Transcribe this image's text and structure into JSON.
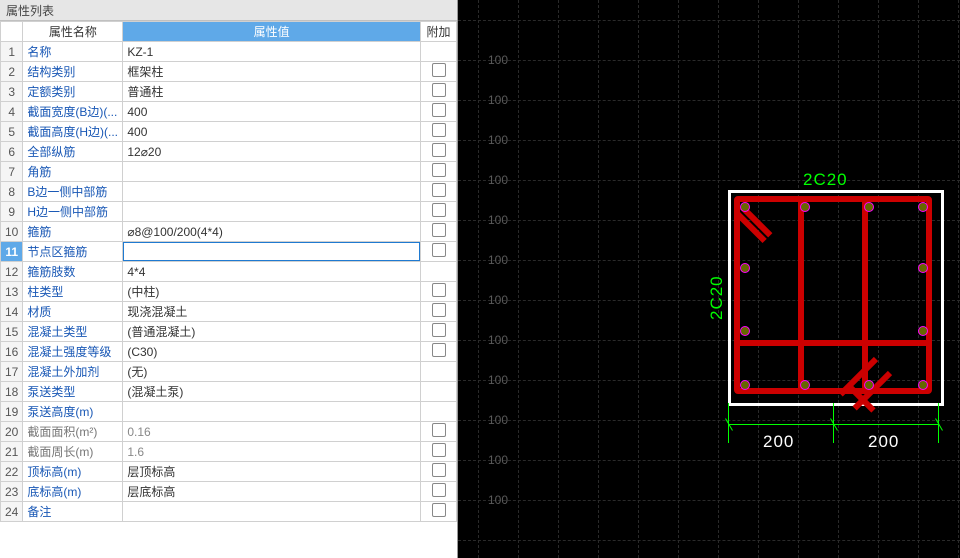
{
  "panel": {
    "title": "属性列表",
    "col_name": "属性名称",
    "col_value": "属性值",
    "col_extra": "附加"
  },
  "selected_row_index": 10,
  "rows": [
    {
      "n": "1",
      "name": "名称",
      "val": "KZ-1",
      "chk": false,
      "edit": false,
      "gray": false
    },
    {
      "n": "2",
      "name": "结构类别",
      "val": "框架柱",
      "chk": true,
      "edit": false,
      "gray": false
    },
    {
      "n": "3",
      "name": "定额类别",
      "val": "普通柱",
      "chk": true,
      "edit": false,
      "gray": false
    },
    {
      "n": "4",
      "name": "截面宽度(B边)(...",
      "val": "400",
      "chk": true,
      "edit": false,
      "gray": false
    },
    {
      "n": "5",
      "name": "截面高度(H边)(...",
      "val": "400",
      "chk": true,
      "edit": false,
      "gray": false
    },
    {
      "n": "6",
      "name": "全部纵筋",
      "val": "12⌀20",
      "chk": true,
      "edit": false,
      "gray": false
    },
    {
      "n": "7",
      "name": "角筋",
      "val": "",
      "chk": true,
      "edit": false,
      "gray": false
    },
    {
      "n": "8",
      "name": "B边一侧中部筋",
      "val": "",
      "chk": true,
      "edit": false,
      "gray": false
    },
    {
      "n": "9",
      "name": "H边一侧中部筋",
      "val": "",
      "chk": true,
      "edit": false,
      "gray": false
    },
    {
      "n": "10",
      "name": "箍筋",
      "val": "⌀8@100/200(4*4)",
      "chk": true,
      "edit": false,
      "gray": false
    },
    {
      "n": "11",
      "name": "节点区箍筋",
      "val": "",
      "chk": true,
      "edit": true,
      "gray": false
    },
    {
      "n": "12",
      "name": "箍筋肢数",
      "val": "4*4",
      "chk": false,
      "edit": false,
      "gray": false
    },
    {
      "n": "13",
      "name": "柱类型",
      "val": "(中柱)",
      "chk": true,
      "edit": false,
      "gray": false
    },
    {
      "n": "14",
      "name": "材质",
      "val": "现浇混凝土",
      "chk": true,
      "edit": false,
      "gray": false
    },
    {
      "n": "15",
      "name": "混凝土类型",
      "val": "(普通混凝土)",
      "chk": true,
      "edit": false,
      "gray": false
    },
    {
      "n": "16",
      "name": "混凝土强度等级",
      "val": "(C30)",
      "chk": true,
      "edit": false,
      "gray": false
    },
    {
      "n": "17",
      "name": "混凝土外加剂",
      "val": "(无)",
      "chk": false,
      "edit": false,
      "gray": false
    },
    {
      "n": "18",
      "name": "泵送类型",
      "val": "(混凝土泵)",
      "chk": false,
      "edit": false,
      "gray": false
    },
    {
      "n": "19",
      "name": "泵送高度(m)",
      "val": "",
      "chk": false,
      "edit": false,
      "gray": false
    },
    {
      "n": "20",
      "name": "截面面积(m²)",
      "val": "0.16",
      "chk": true,
      "edit": false,
      "gray": true
    },
    {
      "n": "21",
      "name": "截面周长(m)",
      "val": "1.6",
      "chk": true,
      "edit": false,
      "gray": true
    },
    {
      "n": "22",
      "name": "顶标高(m)",
      "val": "层顶标高",
      "chk": true,
      "edit": false,
      "gray": false
    },
    {
      "n": "23",
      "name": "底标高(m)",
      "val": "层底标高",
      "chk": true,
      "edit": false,
      "gray": false
    },
    {
      "n": "24",
      "name": "备注",
      "val": "",
      "chk": true,
      "edit": false,
      "gray": false
    }
  ],
  "canvas": {
    "grid_label": "100",
    "rebar_top": "2C20",
    "rebar_left": "2C20",
    "dim_bottom_1": "200",
    "dim_bottom_2": "200"
  }
}
